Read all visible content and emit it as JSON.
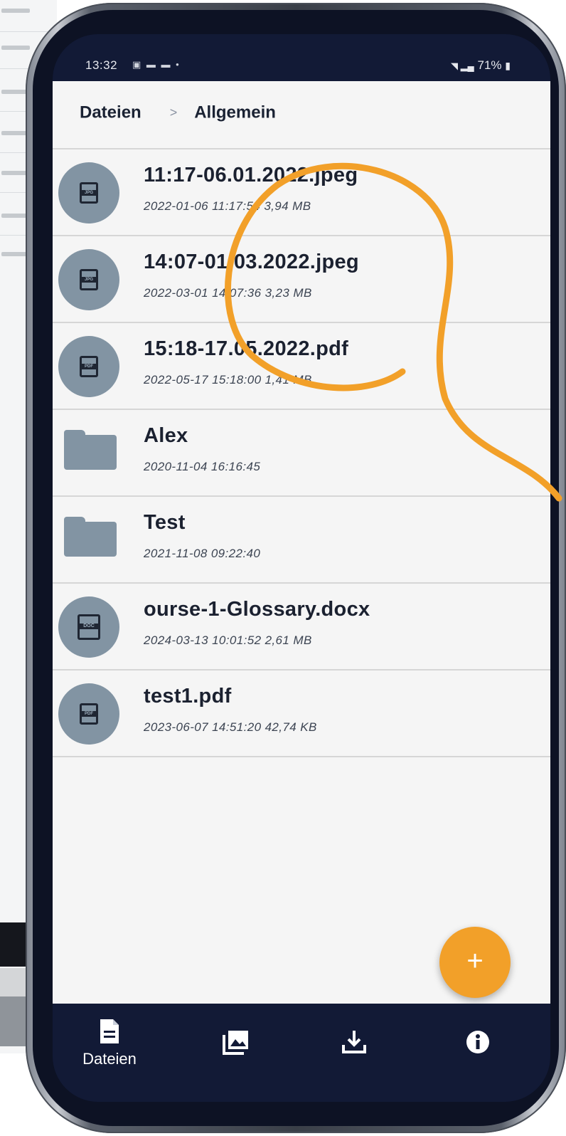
{
  "statusbar": {
    "time": "13:32",
    "battery": "71%"
  },
  "breadcrumb": {
    "root": "Dateien",
    "separator": ">",
    "current": "Allgemein"
  },
  "files": [
    {
      "name": "11:17-06.01.2022.jpeg",
      "meta": "2022-01-06 11:17:54  3,94 MB",
      "icon": "jpg-file-icon",
      "badge": "JPG"
    },
    {
      "name": "14:07-01.03.2022.jpeg",
      "meta": "2022-03-01 14:07:36  3,23 MB",
      "icon": "jpg-file-icon",
      "badge": "JPG"
    },
    {
      "name": "15:18-17.05.2022.pdf",
      "meta": "2022-05-17 15:18:00  1,41 MB",
      "icon": "pdf-file-icon",
      "badge": "PDF"
    },
    {
      "name": "Alex",
      "meta": "2020-11-04 16:16:45",
      "icon": "folder-icon"
    },
    {
      "name": "Test",
      "meta": "2021-11-08 09:22:40",
      "icon": "folder-icon"
    },
    {
      "name": "ourse-1-Glossary.docx",
      "meta": "2024-03-13 10:01:52  2,61 MB",
      "icon": "docx-file-icon",
      "badge": "DOC"
    },
    {
      "name": "test1.pdf",
      "meta": "2023-06-07 14:51:20  42,74 KB",
      "icon": "pdf-file-icon",
      "badge": "PDF"
    }
  ],
  "fab": {
    "label": "+"
  },
  "bottom_nav": [
    {
      "label": "Dateien",
      "icon": "document-icon",
      "active": true
    },
    {
      "label": "",
      "icon": "gallery-icon"
    },
    {
      "label": "",
      "icon": "download-icon"
    },
    {
      "label": "",
      "icon": "info-icon"
    }
  ],
  "colors": {
    "accent": "#f2a029",
    "nav_background": "#121a36",
    "icon_circle": "#8294a3"
  }
}
